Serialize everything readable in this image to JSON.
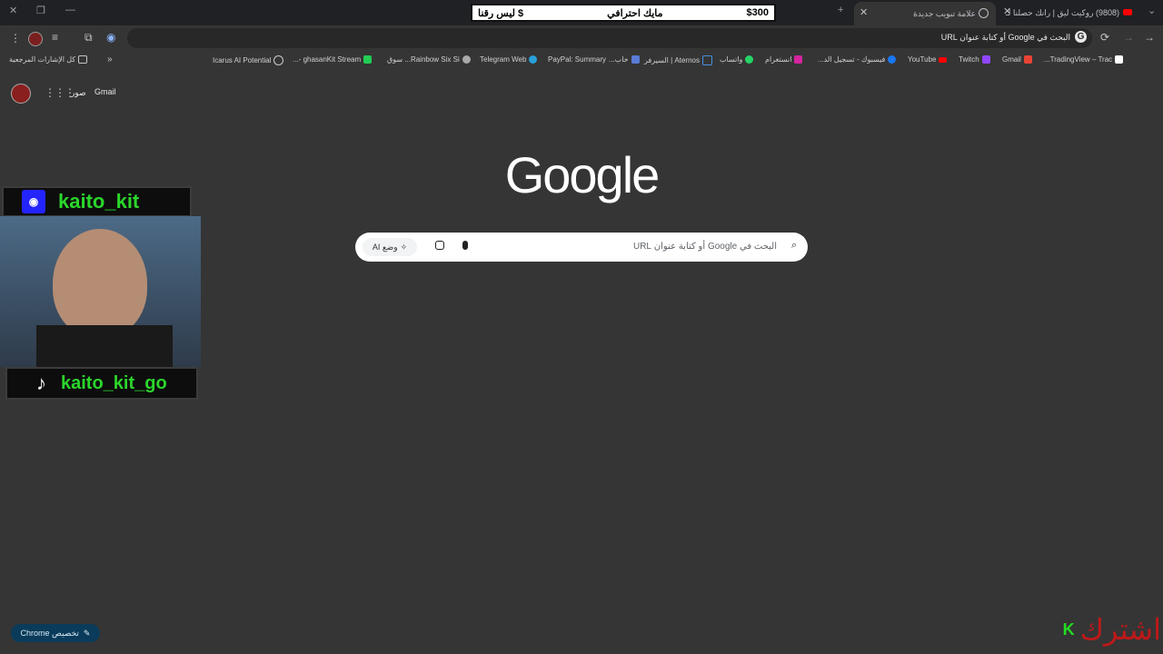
{
  "tabs": [
    {
      "title": "(9808) روكيت ليق | رانك حصلنا لـ",
      "active": false
    },
    {
      "title": "علامة تبويب جديدة",
      "active": true
    }
  ],
  "banner": {
    "amount": "$300",
    "middle": "مايك احترافي",
    "right": "ليس رقنا $"
  },
  "omnibox": {
    "placeholder": "البحث في Google أو كتابة عنوان URL"
  },
  "bookmarks": {
    "all_label": "كل الإشارات المرجعية",
    "items": [
      "TradingView – Trac...",
      "Gmail",
      "Twitch",
      "YouTube",
      "فيسبوك - تسجيل الد...",
      "انستغرام",
      "واتساب",
      "Aternos | السيرفر",
      "خاب...",
      "PayPal: Summary",
      "Telegram Web",
      "Rainbow Six Si... سوق",
      "ghasanKit Stream -...",
      "Icarus AI Potential"
    ]
  },
  "header": {
    "gmail": "Gmail",
    "images": "صور"
  },
  "logo": "Google",
  "search": {
    "placeholder": "البحث في Google أو كتابة عنوان URL",
    "ai_mode": "وضع AI"
  },
  "customize": {
    "label": "تخصيص Chrome"
  },
  "stream": {
    "discord": "kaito_kit",
    "tiktok": "kaito_kit_go"
  },
  "subscribe": {
    "text": "اشترك",
    "k": "K"
  },
  "colors": {
    "bg": "#353535",
    "tabbar": "#202124",
    "google_white": "#ffffff",
    "stream_green": "#2bd62b",
    "subscribe_red": "#c01818",
    "customize_blue": "#0b3b5a"
  }
}
